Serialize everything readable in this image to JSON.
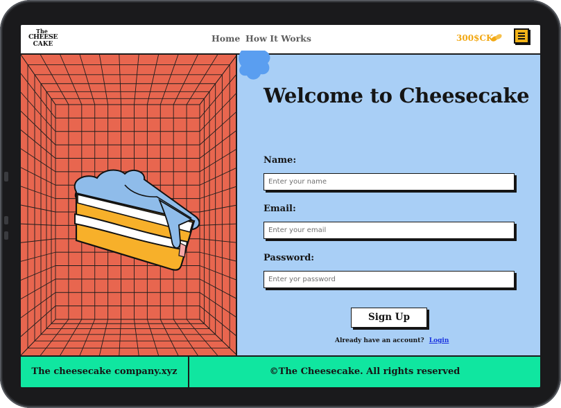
{
  "brand": {
    "logo_line1": "The",
    "logo_line2": "CHEESE",
    "logo_line3": "CAKE"
  },
  "nav": {
    "links": [
      {
        "label": "Home"
      },
      {
        "label": "How It Works"
      }
    ],
    "balance": "300$CK",
    "menu_icon": "hamburger-icon"
  },
  "form": {
    "heading": "Welcome to Cheesecake",
    "name_label": "Name:",
    "name_placeholder": "Enter your name",
    "email_label": "Email:",
    "email_placeholder": "Enter your email",
    "password_label": "Password:",
    "password_placeholder": "Enter yor password",
    "submit_label": "Sign Up",
    "already_text": "Already have an account?",
    "login_label": "Login"
  },
  "footer": {
    "left_text": "The cheesecake company.xyz",
    "right_text": "©The Cheesecake. All rights reserved"
  },
  "colors": {
    "accent_yellow": "#f2b319",
    "left_panel": "#e8664f",
    "right_panel": "#a9cff6",
    "footer": "#10e6a0",
    "login_link": "#1b34e0"
  }
}
